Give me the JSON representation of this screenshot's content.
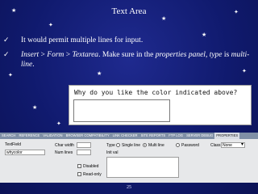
{
  "slide": {
    "title": "Text Area",
    "bullets": [
      {
        "mark": "✓",
        "parts": [
          "It would permit multiple lines for input."
        ]
      },
      {
        "mark": "✓",
        "parts": [
          "Insert",
          " > ",
          "Form",
          " > ",
          "Textarea",
          ". Make sure in the ",
          "properties panel",
          ", ",
          "type",
          " is ",
          "multi-line",
          "."
        ]
      }
    ],
    "page_number": "25"
  },
  "example": {
    "question": "Why do you like the color indicated above?"
  },
  "panel_tabs": [
    "SEARCH",
    "REFERENCE",
    "VALIDATION",
    "BROWSER COMPATIBILITY",
    "LINK CHECKER",
    "SITE REPORTS",
    "FTP LOG",
    "SERVER DEBUG",
    "PROPERTIES"
  ],
  "properties": {
    "element_type": "TextField",
    "name_value": "whycolor",
    "char_width_label": "Char width",
    "num_lines_label": "Num lines",
    "type_label": "Type",
    "type_options": [
      "Single line",
      "Multi line",
      "Password"
    ],
    "init_val_label": "Init val",
    "class_label": "Class",
    "class_value": "None",
    "disabled_label": "Disabled",
    "readonly_label": "Read-only"
  }
}
